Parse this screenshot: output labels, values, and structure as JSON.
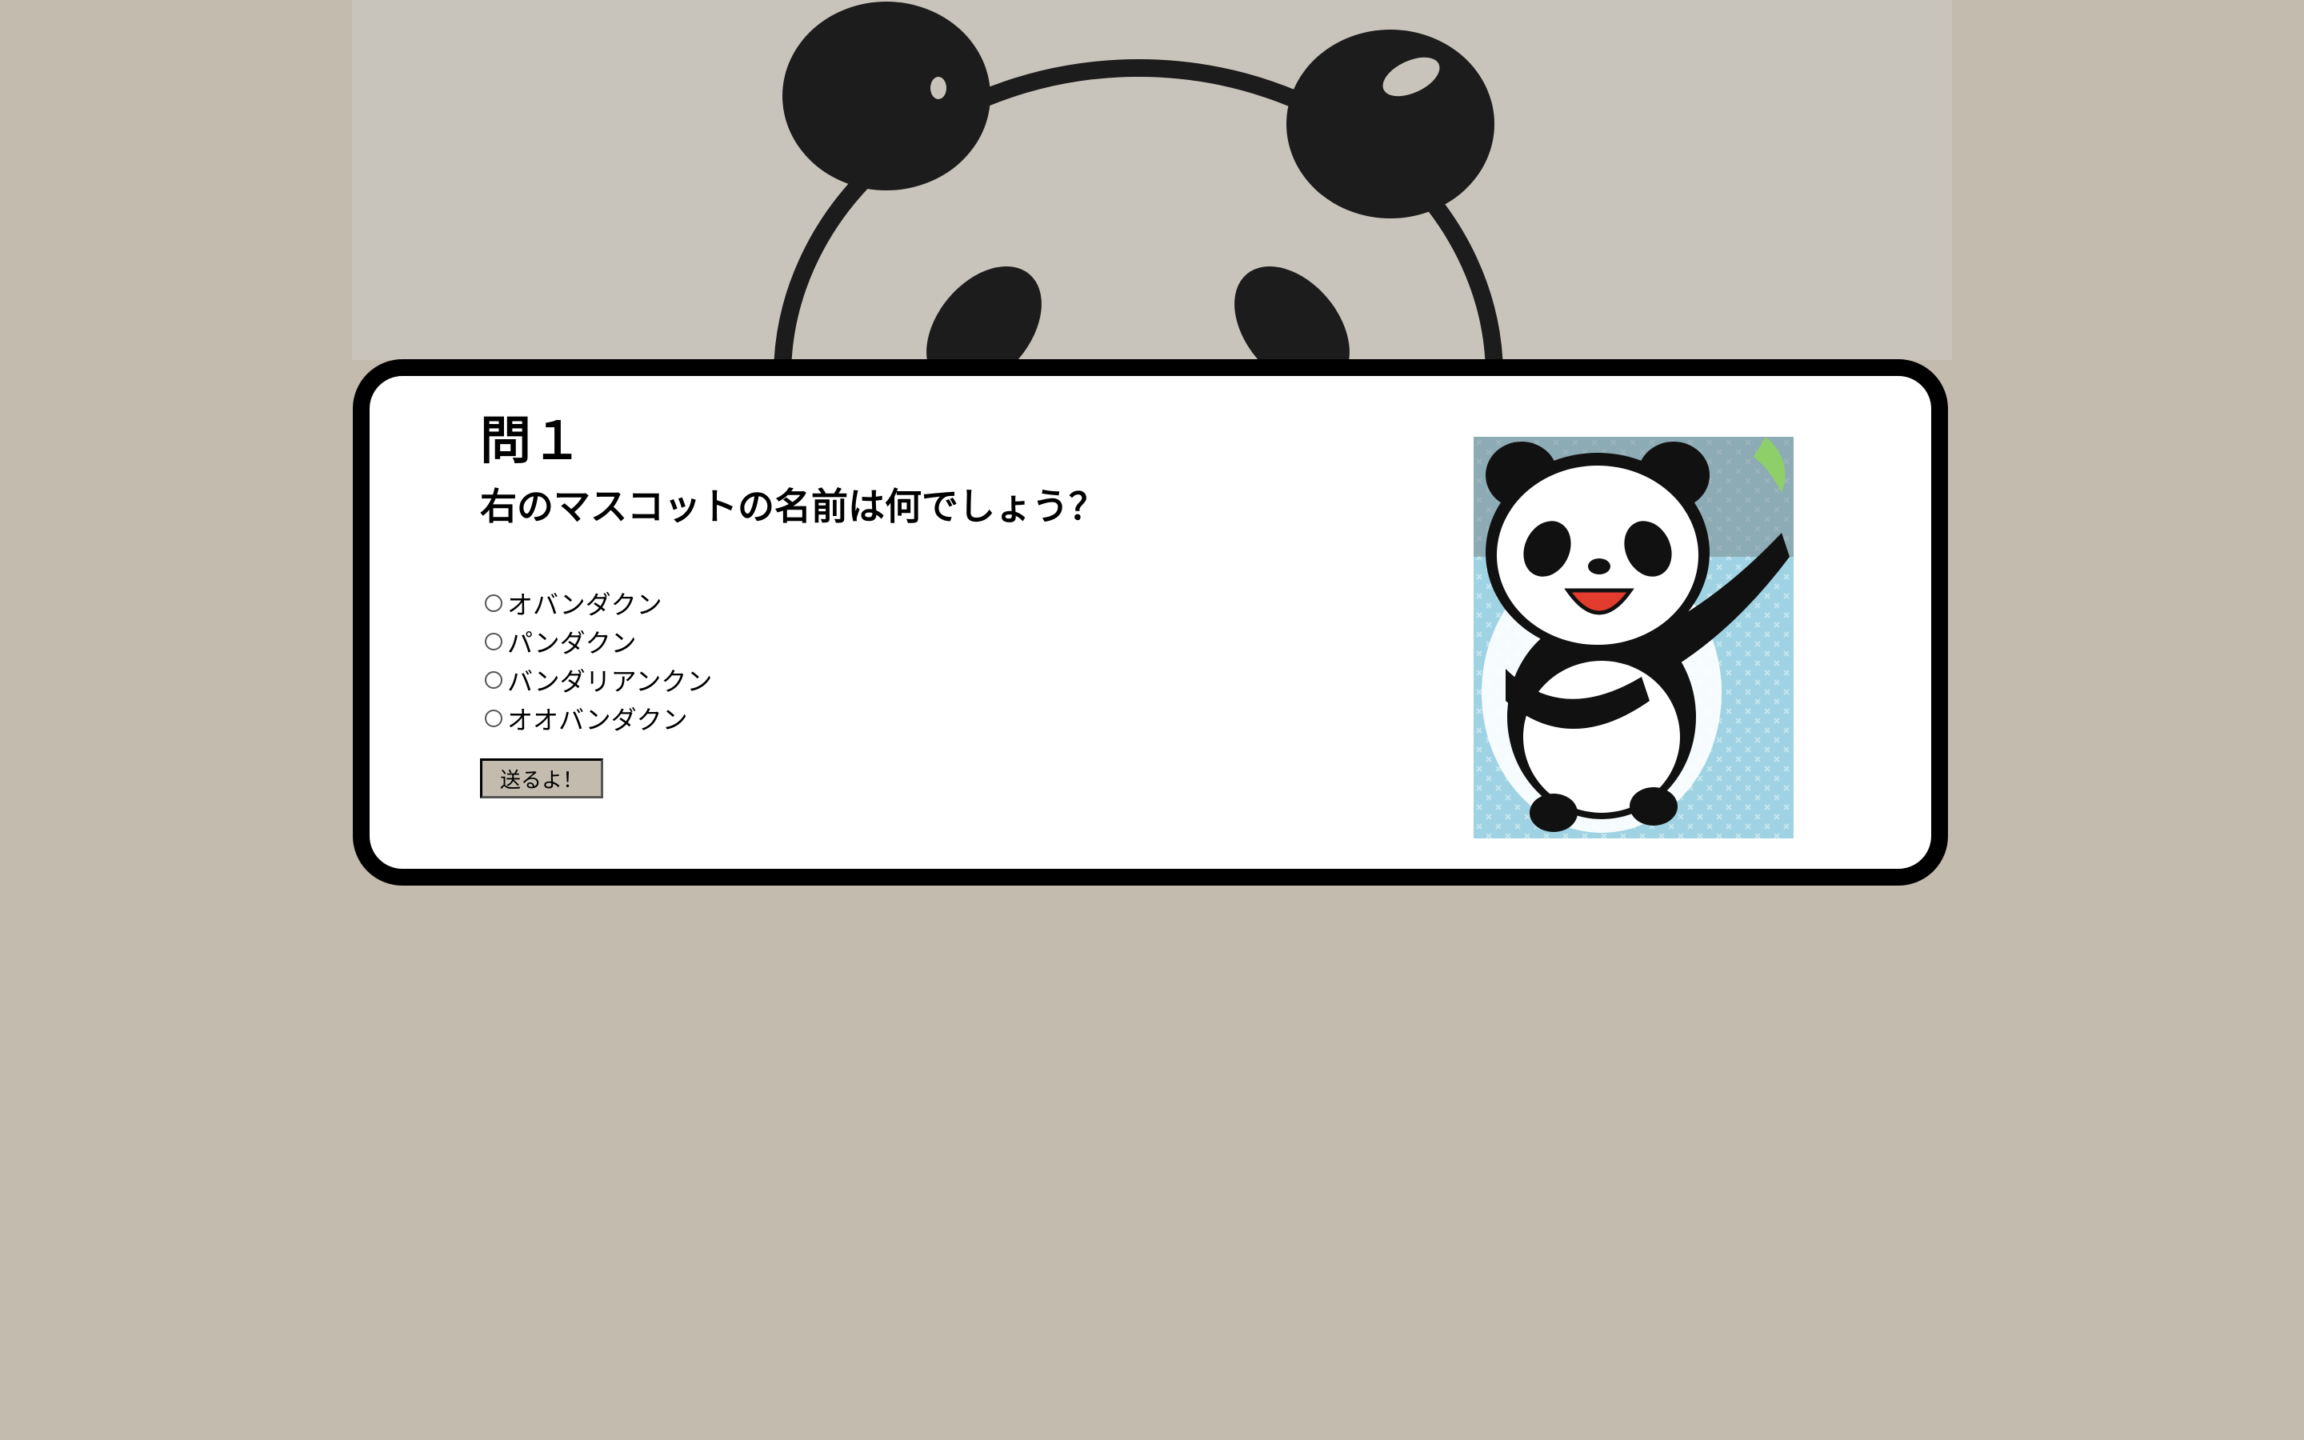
{
  "page": {
    "background_color": "#c3bbae",
    "header_art_icon": "panda-face-illustration"
  },
  "question": {
    "number": "問１",
    "text": "右のマスコットの名前は何でしょう？",
    "choices": [
      {
        "label": "オバンダクン"
      },
      {
        "label": "パンダクン"
      },
      {
        "label": "バンダリアンクン"
      },
      {
        "label": "オオバンダクン"
      }
    ],
    "submit_label": "送るよ！"
  },
  "mascot": {
    "icon": "waving-panda-mascot",
    "background_color": "#9fd3e3"
  },
  "colors": {
    "card_border": "#000000",
    "card_background": "#ffffff",
    "button_background": "#c3bbae"
  }
}
